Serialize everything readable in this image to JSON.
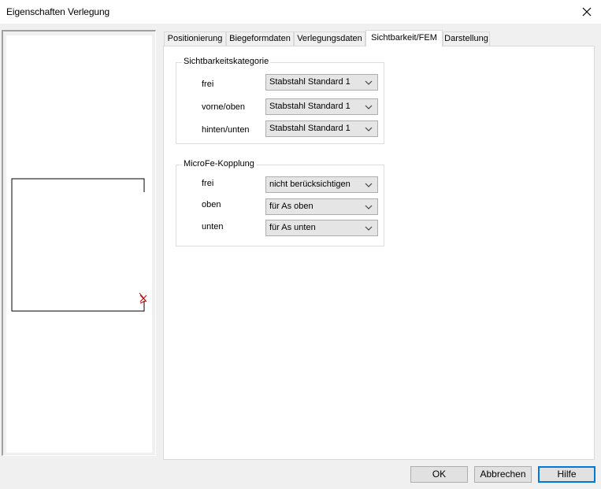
{
  "window": {
    "title": "Eigenschaften Verlegung",
    "close_icon": "close-icon"
  },
  "tabs": [
    {
      "label": "Positionierung",
      "active": false
    },
    {
      "label": "Biegeformdaten",
      "active": false
    },
    {
      "label": "Verlegungsdaten",
      "active": false
    },
    {
      "label": "Sichtbarkeit/FEM",
      "active": true
    },
    {
      "label": "Darstellung",
      "active": false
    }
  ],
  "sichtbarkeit": {
    "title": "Sichtbarkeitskategorie",
    "rows": [
      {
        "label": "frei",
        "value": "Stabstahl Standard 1"
      },
      {
        "label": "vorne/oben",
        "value": "Stabstahl Standard 1"
      },
      {
        "label": "hinten/unten",
        "value": "Stabstahl Standard 1"
      }
    ]
  },
  "microfe": {
    "title": "MicroFe-Kopplung",
    "rows": [
      {
        "label": "frei",
        "value": "nicht berücksichtigen"
      },
      {
        "label": "oben",
        "value": "für As oben"
      },
      {
        "label": "unten",
        "value": "für As unten"
      }
    ]
  },
  "buttons": {
    "ok": "OK",
    "cancel": "Abbrechen",
    "help": "Hilfe"
  },
  "colors": {
    "shape_line": "#000000",
    "marker": "#c00000",
    "default_button_border": "#0078d7"
  }
}
